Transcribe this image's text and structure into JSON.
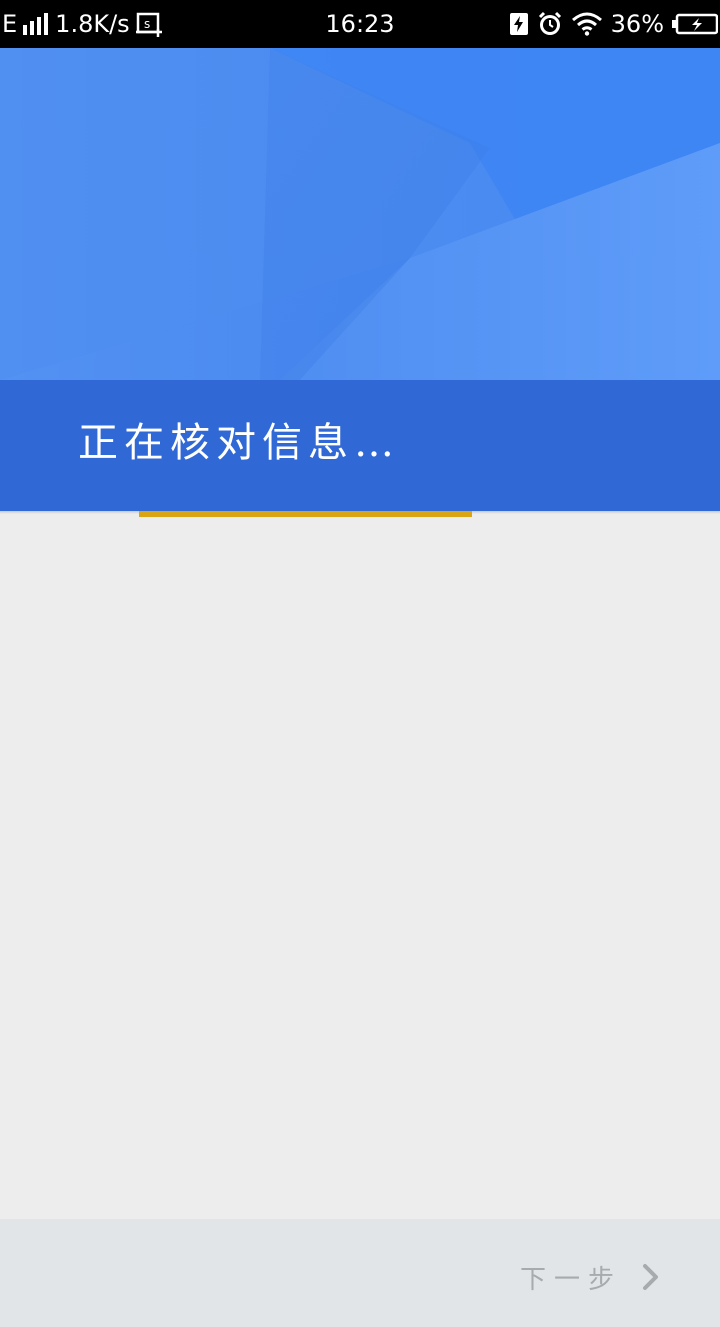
{
  "status_bar": {
    "network_type": "E",
    "speed": "1.8K/s",
    "time": "16:23",
    "battery": "36%"
  },
  "header": {
    "title": "正在核对信息…"
  },
  "progress": {
    "fraction": 0.46
  },
  "footer": {
    "next_label": "下一步"
  },
  "colors": {
    "hero": "#4a88ef",
    "title_band": "#3068d5",
    "progress_accent": "#d9a514",
    "content_bg": "#ededed",
    "footer_bg": "#e2e5e8",
    "next_text": "#a8abae"
  },
  "icons": {
    "signal": "signal-bars-icon",
    "screenshot": "screenshot-icon",
    "charging": "charging-icon",
    "alarm": "alarm-icon",
    "wifi": "wifi-icon",
    "battery": "battery-icon",
    "next": "chevron-right-icon"
  }
}
